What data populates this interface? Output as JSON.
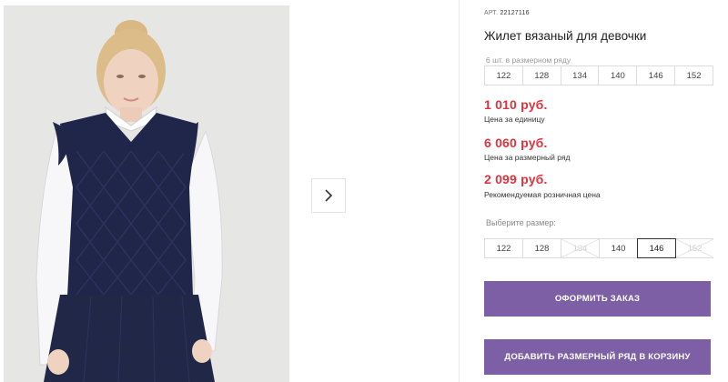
{
  "product": {
    "art_label": "АРТ.",
    "art_value": "22127116",
    "title": "Жилет вязаный для девочки"
  },
  "size_row": {
    "caption": "6 шт. в размерном ряду",
    "sizes": [
      "122",
      "128",
      "134",
      "140",
      "146",
      "152"
    ]
  },
  "prices": {
    "unit_price": "1 010 руб.",
    "unit_label": "Цена за единицу",
    "row_price": "6 060 руб.",
    "row_label": "Цена за размерный ряд",
    "retail_price": "2 099 руб.",
    "retail_label": "Рекомендуемая розничная цена"
  },
  "size_picker": {
    "label": "Выберите размер:",
    "sizes": [
      {
        "label": "122",
        "state": "available"
      },
      {
        "label": "128",
        "state": "available"
      },
      {
        "label": "134",
        "state": "unavailable"
      },
      {
        "label": "140",
        "state": "available"
      },
      {
        "label": "146",
        "state": "selected"
      },
      {
        "label": "152",
        "state": "unavailable"
      }
    ]
  },
  "buttons": {
    "order": "ОФОРМИТЬ ЗАКАЗ",
    "add_row_to_cart": "ДОБАВИТЬ РАЗМЕРНЫЙ РЯД В КОРЗИНУ"
  },
  "gallery": {
    "next_icon": "chevron-right-icon"
  },
  "colors": {
    "accent": "#7c5fa4",
    "price": "#e0333d"
  }
}
